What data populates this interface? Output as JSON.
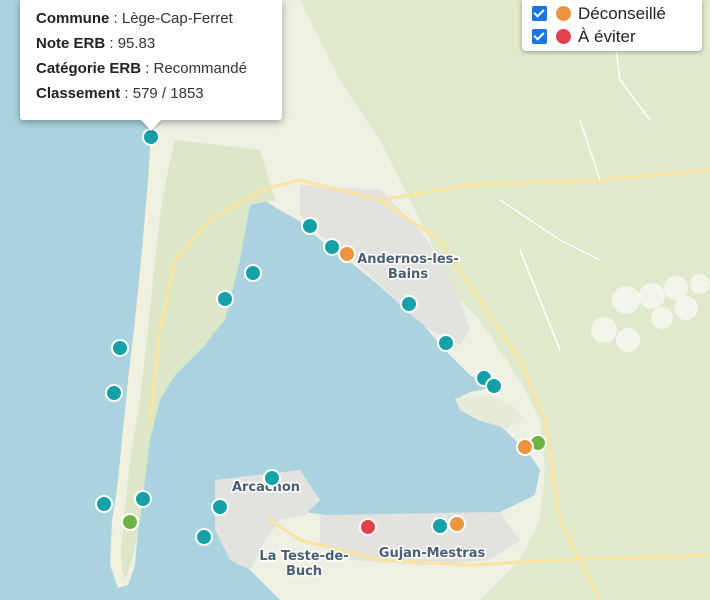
{
  "colors": {
    "recommande": "#16a0a8",
    "bien": "#6cb543",
    "deconseille": "#ed9441",
    "eviter": "#e0434e",
    "water": "#aad3df",
    "land": "#eef0e3"
  },
  "popup": {
    "commune_label": "Commune",
    "commune_value": "Lège-Cap-Ferret",
    "note_label": "Note ERB",
    "note_value": "95.83",
    "categorie_label": "Catégorie ERB",
    "categorie_value": "Recommandé",
    "classement_label": "Classement",
    "classement_value": "579 / 1853"
  },
  "legend": {
    "items": [
      {
        "label": "Déconseillé",
        "checked": true,
        "color": "#ed9441"
      },
      {
        "label": "À éviter",
        "checked": true,
        "color": "#e0434e"
      }
    ]
  },
  "towns": {
    "andernos_line1": "Andernos-les-",
    "andernos_line2": "Bains",
    "arcachon": "Arcachon",
    "teste_line1": "La Teste-de-",
    "teste_line2": "Buch",
    "gujan": "Gujan-Mestras"
  },
  "markers_summary": {
    "recommande": 20,
    "bien": 2,
    "deconseille": 3,
    "eviter": 1
  }
}
